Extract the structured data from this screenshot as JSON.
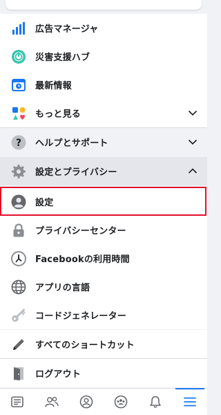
{
  "menu": {
    "ads_manager": "広告マネージャ",
    "crisis_response": "災害支援ハブ",
    "most_recent": "最新情報",
    "see_more": "もっと見る",
    "help_support": "ヘルプとサポート",
    "settings_privacy": "設定とプライバシー",
    "settings": "設定",
    "privacy_center": "プライバシーセンター",
    "your_time": "Facebookの利用時間",
    "app_language": "アプリの言語",
    "code_generator": "コードジェネレーター",
    "all_shortcuts": "すべてのショートカット",
    "log_out": "ログアウト"
  },
  "colors": {
    "accent": "#1877f2",
    "selection_outline": "#e0102a",
    "section_bg": "#f0f2f5"
  },
  "icons": {
    "ads_manager": "bar-chart-icon",
    "crisis_response": "power-circle-icon",
    "most_recent": "calendar-clock-icon",
    "see_more": "shapes-icon",
    "help_support": "question-icon",
    "settings_privacy": "gear-icon",
    "settings": "person-icon",
    "privacy_center": "lock-icon",
    "your_time": "clock-icon",
    "app_language": "globe-icon",
    "code_generator": "key-icon",
    "all_shortcuts": "pencil-icon",
    "log_out": "door-icon"
  },
  "tabbar": {
    "tabs": [
      "news-feed-icon",
      "friends-icon",
      "profile-icon",
      "groups-icon",
      "notifications-bell-icon",
      "menu-icon"
    ],
    "active_index": 5
  }
}
